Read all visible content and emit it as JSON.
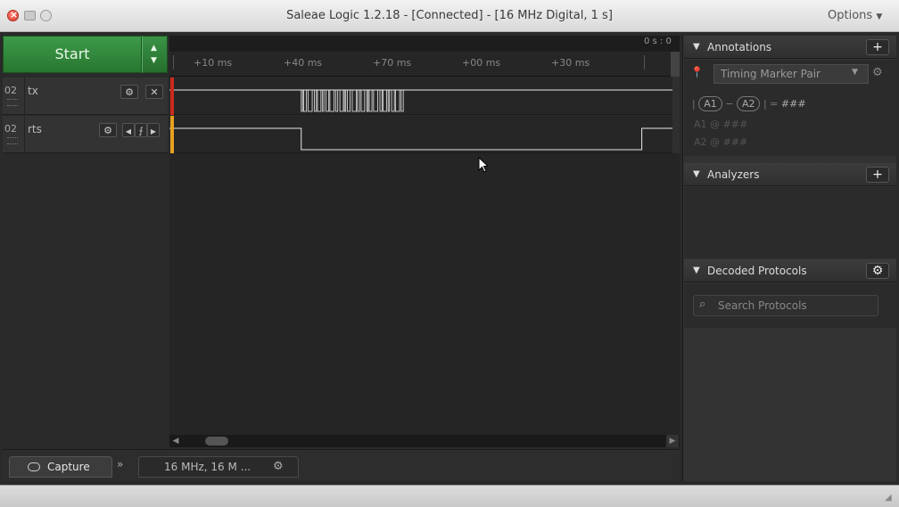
{
  "window": {
    "title": "Saleae Logic 1.2.18 - [Connected] - [16 MHz Digital, 1 s]",
    "options_label": "Options"
  },
  "capture": {
    "start_label": "Start"
  },
  "channels": [
    {
      "number": "02",
      "name": "tx"
    },
    {
      "number": "02",
      "name": "rts"
    }
  ],
  "ruler": {
    "readout": "0 s : 0",
    "ticks": [
      "+10 ms",
      "+40 ms",
      "+70 ms",
      "+00 ms",
      "+30 ms"
    ]
  },
  "bottom_tabs": {
    "capture_label": "Capture",
    "settings_label": "16 MHz, 16 M ..."
  },
  "annotations": {
    "title": "Annotations",
    "marker_pair": "Timing Marker Pair",
    "a1": "A1",
    "a2": "A2",
    "diff_value": "###",
    "a1_row_label": "A1",
    "a1_row_value": "###",
    "a2_row_label": "A2",
    "a2_row_value": "###"
  },
  "analyzers": {
    "title": "Analyzers"
  },
  "decoded": {
    "title": "Decoded Protocols",
    "search_placeholder": "Search Protocols"
  },
  "colors": {
    "accent_green": "#2e8b3a",
    "tx_marker": "#cc2a1e",
    "rts_marker": "#e8a020",
    "trace": "#e8e8e8"
  },
  "signals": {
    "tx": {
      "burst_start": 0.262,
      "burst_end": 0.465
    },
    "rts": {
      "low_start": 0.262,
      "low_end": 0.939
    }
  }
}
